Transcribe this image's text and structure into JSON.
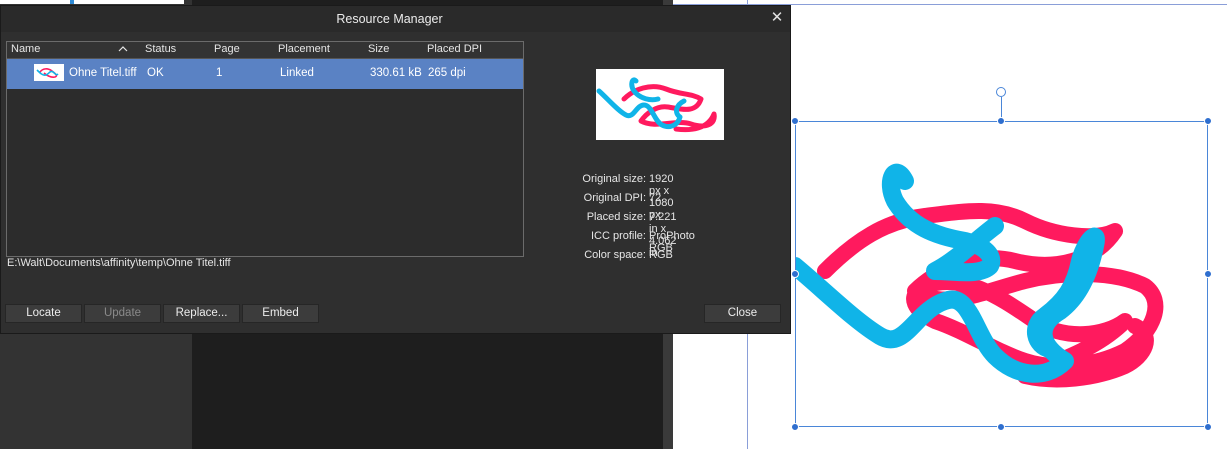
{
  "dialog": {
    "title": "Resource Manager",
    "close_glyph": "✕"
  },
  "list": {
    "columns": [
      "Name",
      "Status",
      "Page",
      "Placement",
      "Size",
      "Placed DPI"
    ],
    "sort_icon": "chevron-up-icon",
    "rows": [
      {
        "name": "Ohne Titel.tiff",
        "status": "OK",
        "page": "1",
        "placement": "Linked",
        "size": "330.61 kB",
        "dpi": "265 dpi"
      }
    ]
  },
  "file_path": "E:\\Walt\\Documents\\affinity\\temp\\Ohne Titel.tiff",
  "info": {
    "original_size_label": "Original size:",
    "original_size_value": "1920 px x 1080 px",
    "original_dpi_label": "Original DPI:",
    "original_dpi_value": "72",
    "placed_size_label": "Placed size:",
    "placed_size_value": "7.221 in x 4.062 in",
    "icc_label": "ICC profile:",
    "icc_value": "ProPhoto RGB",
    "color_space_label": "Color space:",
    "color_space_value": "RGB"
  },
  "buttons": {
    "locate": "Locate",
    "update": "Update",
    "replace": "Replace...",
    "embed": "Embed",
    "close": "Close"
  },
  "colors": {
    "selection": "#5a82c4",
    "stroke_pink": "#ff1a5e",
    "stroke_cyan": "#10b4e8",
    "handle": "#2f6fcf"
  }
}
